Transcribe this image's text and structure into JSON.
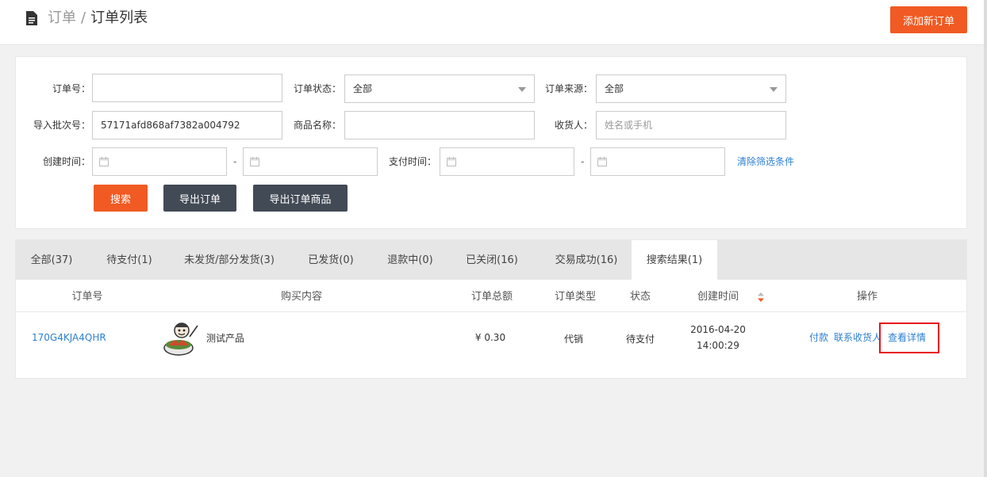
{
  "header": {
    "breadcrumb_parent": "订单",
    "breadcrumb_sep": "/",
    "breadcrumb_current": "订单列表",
    "add_button": "添加新订单"
  },
  "filters": {
    "order_no_label": "订单号：",
    "order_no_value": "",
    "order_status_label": "订单状态：",
    "order_status_value": "全部",
    "order_source_label": "订单来源：",
    "order_source_value": "全部",
    "batch_label": "导入批次号：",
    "batch_value": "57171afd868af7382a004792",
    "product_label": "商品名称：",
    "product_value": "",
    "receiver_label": "收货人：",
    "receiver_placeholder": "姓名或手机",
    "created_label": "创建时间：",
    "paid_label": "支付时间：",
    "range_sep": "-",
    "clear_link": "清除筛选条件",
    "search_button": "搜索",
    "export_orders_button": "导出订单",
    "export_products_button": "导出订单商品"
  },
  "tabs": [
    {
      "label": "全部(37)"
    },
    {
      "label": "待支付(1)"
    },
    {
      "label": "未发货/部分发货(3)"
    },
    {
      "label": "已发货(0)"
    },
    {
      "label": "退款中(0)"
    },
    {
      "label": "已关闭(16)"
    },
    {
      "label": "交易成功(16)"
    },
    {
      "label": "搜索结果(1)",
      "active": true
    }
  ],
  "table": {
    "headers": [
      "订单号",
      "购买内容",
      "订单总额",
      "订单类型",
      "状态",
      "创建时间",
      "操作"
    ],
    "rows": [
      {
        "order_no": "170G4KJA4QHR",
        "product_name": "测试产品",
        "total": "¥ 0.30",
        "type": "代销",
        "status": "待支付",
        "created_date": "2016-04-20",
        "created_time": "14:00:29",
        "actions": [
          "付款",
          "联系收货人",
          "查看详情"
        ]
      }
    ]
  },
  "colors": {
    "accent": "#f15a22",
    "dark_button": "#424a55",
    "link": "#2f80d1",
    "highlight": "#e8141b"
  }
}
